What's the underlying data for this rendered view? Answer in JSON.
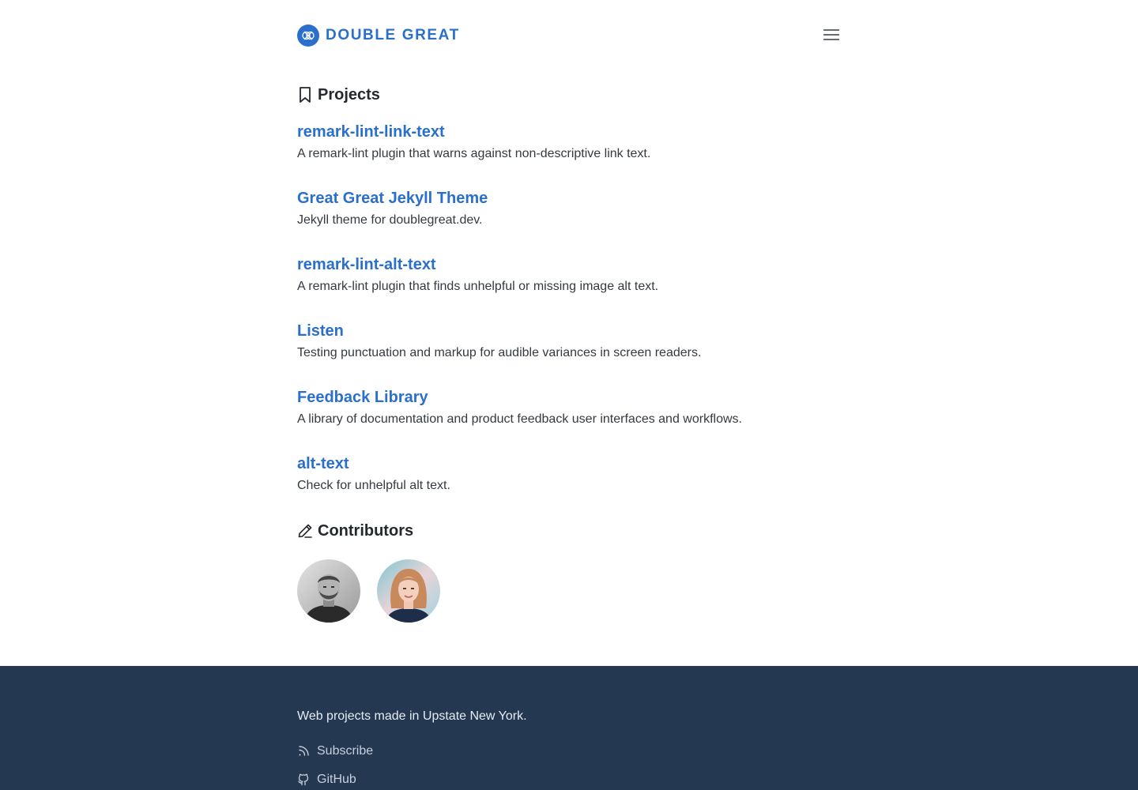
{
  "header": {
    "brand_name": "DOUBLE GREAT",
    "logo_icon": "double-great-logo-icon",
    "menu_icon": "hamburger-menu-icon"
  },
  "projects": {
    "title": "Projects",
    "icon": "bookmark-icon",
    "items": [
      {
        "name": "remark-lint-link-text",
        "description": "A remark-lint plugin that warns against non-descriptive link text."
      },
      {
        "name": "Great Great Jekyll Theme",
        "description": "Jekyll theme for doublegreat.dev."
      },
      {
        "name": "remark-lint-alt-text",
        "description": "A remark-lint plugin that finds unhelpful or missing image alt text."
      },
      {
        "name": "Listen",
        "description": "Testing punctuation and markup for audible variances in screen readers."
      },
      {
        "name": "Feedback Library",
        "description": "A library of documentation and product feedback user interfaces and workflows."
      },
      {
        "name": "alt-text",
        "description": "Check for unhelpful alt text."
      }
    ]
  },
  "contributors": {
    "title": "Contributors",
    "icon": "pencil-icon",
    "avatars": [
      "contributor-avatar-1",
      "contributor-avatar-2"
    ]
  },
  "footer": {
    "tagline": "Web projects made in Upstate New York.",
    "links": [
      {
        "label": "Subscribe",
        "icon": "rss-icon"
      },
      {
        "label": "GitHub",
        "icon": "github-icon"
      }
    ]
  },
  "colors": {
    "brand": "#2a6fcc",
    "text": "#333a42",
    "footer_bg": "#243852"
  }
}
